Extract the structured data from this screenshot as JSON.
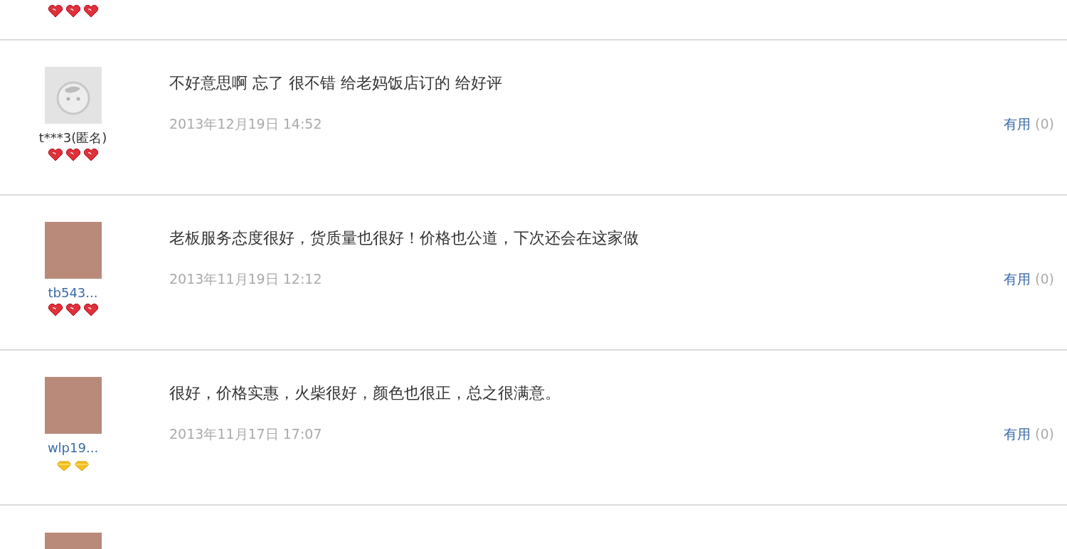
{
  "top_fragment": {
    "badges": [
      {
        "kind": "heart"
      },
      {
        "kind": "heart"
      },
      {
        "kind": "heart"
      }
    ]
  },
  "reviews": [
    {
      "avatar": {
        "kind": "default"
      },
      "user": "t***3(匿名)",
      "anonymous": true,
      "badges": [
        {
          "kind": "heart"
        },
        {
          "kind": "heart"
        },
        {
          "kind": "heart"
        }
      ],
      "comment": "不好意思啊 忘了 很不错 给老妈饭店订的 给好评",
      "date": "2013年12月19日 14:52",
      "useful_label": "有用",
      "useful_count": "(0)"
    },
    {
      "avatar": {
        "kind": "photo"
      },
      "user": "tb543...",
      "anonymous": false,
      "badges": [
        {
          "kind": "heart"
        },
        {
          "kind": "heart"
        },
        {
          "kind": "heart"
        }
      ],
      "comment": "老板服务态度很好，货质量也很好！价格也公道，下次还会在这家做",
      "date": "2013年11月19日 12:12",
      "useful_label": "有用",
      "useful_count": "(0)"
    },
    {
      "avatar": {
        "kind": "photo"
      },
      "user": "wlp19...",
      "anonymous": false,
      "badges": [
        {
          "kind": "diamond"
        },
        {
          "kind": "diamond"
        }
      ],
      "comment": "很好，价格实惠，火柴很好，颜色也很正，总之很满意。",
      "date": "2013年11月17日 17:07",
      "useful_label": "有用",
      "useful_count": "(0)"
    }
  ],
  "partial_review": {
    "avatar": {
      "kind": "photo"
    }
  }
}
